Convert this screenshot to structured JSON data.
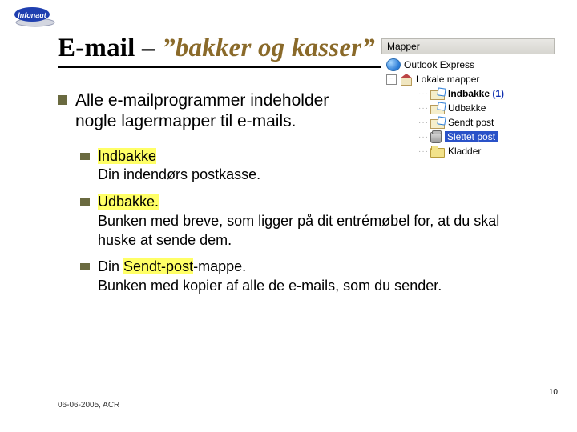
{
  "logo_text": "Infonaut",
  "title": {
    "plain": "E-mail – ",
    "italic": "”bakker og kasser”"
  },
  "intro": "Alle e-mailprogrammer indeholder nogle lagermapper til  e-mails.",
  "items": [
    {
      "head": "Indbakke",
      "rest": "Din indendørs postkasse."
    },
    {
      "head": "Udbakke.",
      "rest": "Bunken med breve, som ligger på dit entrémøbel for, at du skal huske at sende dem."
    },
    {
      "head": "",
      "rest_pre": "Din ",
      "rest_hl": "Sendt-post",
      "rest_post": "-mappe.\nBunken med kopier af alle de e-mails, som du sender."
    }
  ],
  "tree": {
    "header": "Mapper",
    "root": "Outlook Express",
    "local": "Lokale mapper",
    "inbox": "Indbakke",
    "inbox_count": "(1)",
    "outbox": "Udbakke",
    "sent": "Sendt post",
    "deleted": "Slettet post",
    "drafts": "Kladder"
  },
  "footer": "06-06-2005, ACR",
  "pageno": "10"
}
